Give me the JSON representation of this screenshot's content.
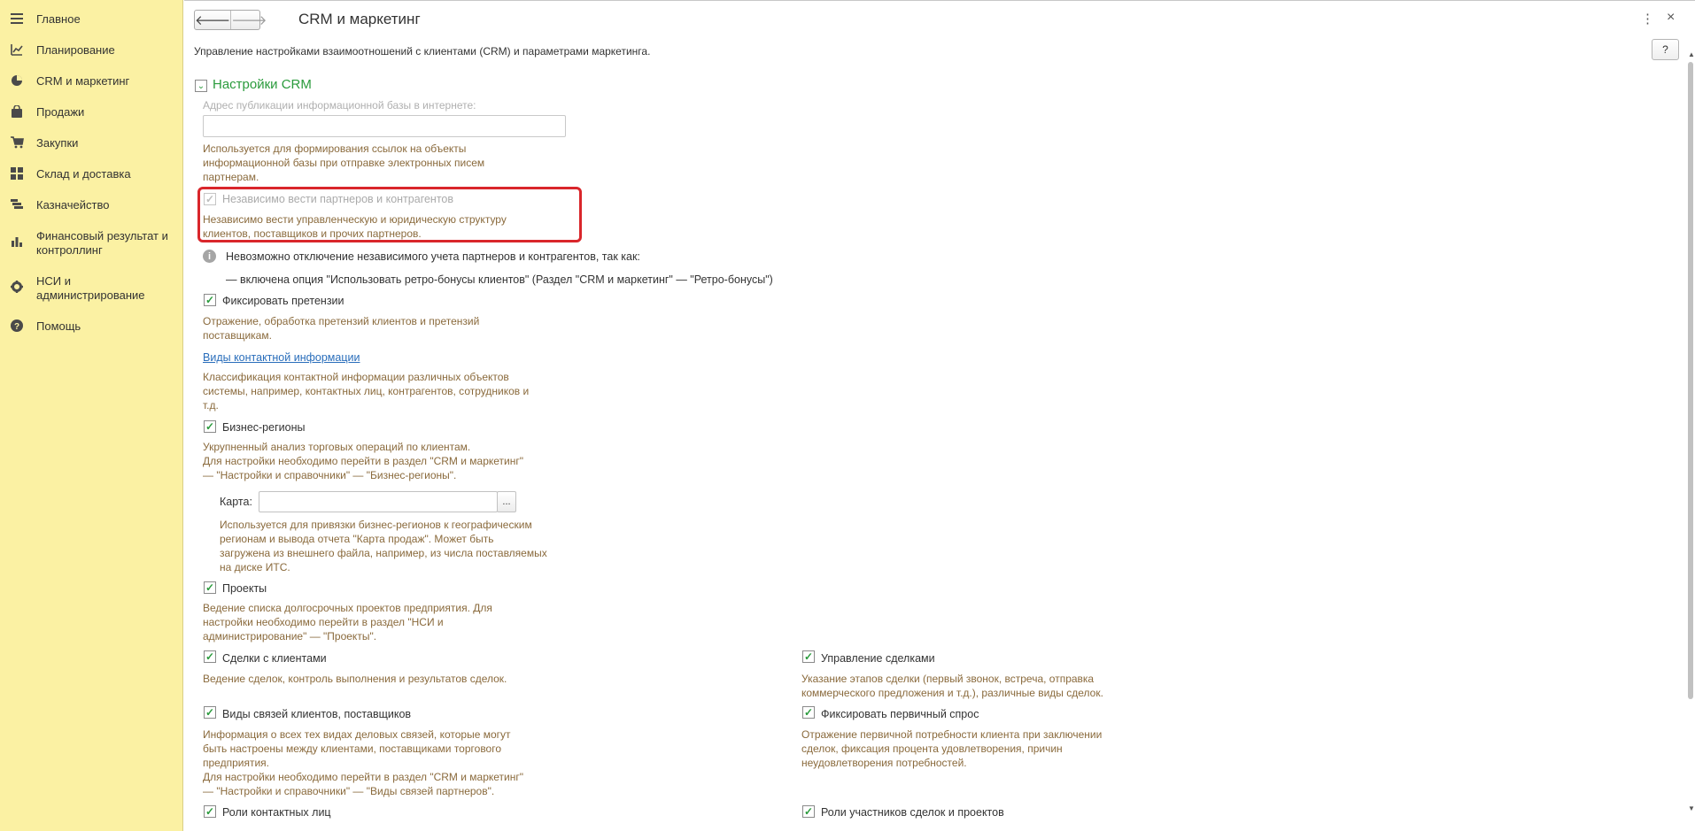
{
  "sidebar": {
    "items": [
      {
        "icon": "hamburger-icon",
        "label": "Главное"
      },
      {
        "icon": "planning-icon",
        "label": "Планирование"
      },
      {
        "icon": "pie-chart-icon",
        "label": "CRM и маркетинг"
      },
      {
        "icon": "bag-icon",
        "label": "Продажи"
      },
      {
        "icon": "cart-icon",
        "label": "Закупки"
      },
      {
        "icon": "warehouse-icon",
        "label": "Склад и доставка"
      },
      {
        "icon": "treasury-icon",
        "label": "Казначейство"
      },
      {
        "icon": "bar-chart-icon",
        "label": "Финансовый результат и контроллинг"
      },
      {
        "icon": "gear-icon",
        "label": "НСИ и администрирование"
      },
      {
        "icon": "help-icon",
        "label": "Помощь"
      }
    ]
  },
  "header": {
    "back_label": "🡐",
    "forward_label": "🡒",
    "title": "CRM и маркетинг",
    "menu_label": "⋮",
    "close_label": "×",
    "subtitle": "Управление настройками взаимоотношений с клиентами (CRM) и параметрами маркетинга.",
    "help_label": "?"
  },
  "section": {
    "toggle_glyph": "⌄",
    "title": "Настройки CRM",
    "publication_address": {
      "label": "Адрес публикации информационной базы в интернете:",
      "value": "",
      "description": [
        "Используется для формирования ссылок на объекты",
        "информационной базы при отправке электронных писем",
        "партнерам."
      ]
    },
    "independent_partners": {
      "checked": true,
      "disabled": true,
      "label": "Независимо вести партнеров и контрагентов",
      "description": [
        "Независимо вести управленческую и юридическую структуру",
        "клиентов, поставщиков и прочих партнеров."
      ]
    },
    "info": {
      "icon": "info-icon",
      "text": "Невозможно отключение независимого учета партнеров и контрагентов, так как:",
      "reason": "— включена опция \"Использовать ретро-бонусы клиентов\" (Раздел \"CRM и маркетинг\" — \"Ретро-бонусы\")"
    },
    "claims": {
      "checked": true,
      "label": "Фиксировать претензии",
      "description": [
        "Отражение, обработка претензий клиентов и претензий",
        "поставщикам."
      ]
    },
    "contact_info_link": {
      "label": "Виды контактной информации",
      "description": [
        "Классификация контактной информации различных объектов",
        "системы, например, контактных лиц, контрагентов, сотрудников и",
        "т.д."
      ]
    },
    "business_regions": {
      "checked": true,
      "label": "Бизнес-регионы",
      "description": [
        "Укрупненный анализ торговых операций по клиентам.",
        "Для настройки необходимо перейти в раздел \"CRM и маркетинг\"",
        "— \"Настройки и справочники\" — \"Бизнес-регионы\"."
      ],
      "map_label": "Карта:",
      "map_value": "",
      "map_button": "...",
      "map_description": [
        "Используется для привязки бизнес-регионов к географическим",
        "регионам и вывода отчета \"Карта продаж\". Может быть",
        "загружена из внешнего файла, например, из числа поставляемых",
        "на диске ИТС."
      ]
    },
    "projects": {
      "checked": true,
      "label": "Проекты",
      "description": [
        "Ведение списка долгосрочных проектов предприятия. Для",
        "настройки необходимо перейти в раздел \"НСИ и",
        "администрирование\" — \"Проекты\"."
      ]
    },
    "deals": {
      "checked": true,
      "label": "Сделки с клиентами",
      "description": [
        "Ведение сделок, контроль выполнения и результатов сделок."
      ]
    },
    "deal_management": {
      "checked": true,
      "label": "Управление сделками",
      "description": [
        "Указание этапов сделки (первый звонок, встреча, отправка",
        "коммерческого предложения и т.д.), различные виды сделок."
      ]
    },
    "relations": {
      "checked": true,
      "label": "Виды связей клиентов, поставщиков",
      "description": [
        "Информация о всех тех видах деловых связей, которые могут",
        "быть настроены между клиентами, поставщиками торгового",
        "предприятия.",
        "Для настройки необходимо перейти в раздел \"CRM и маркетинг\"",
        "— \"Настройки и справочники\" — \"Виды связей партнеров\"."
      ]
    },
    "primary_demand": {
      "checked": true,
      "label": "Фиксировать первичный спрос",
      "description": [
        "Отражение первичной потребности клиента при заключении",
        "сделок, фиксация процента удовлетворения, причин",
        "неудовлетворения потребностей."
      ]
    },
    "contact_roles": {
      "checked": true,
      "label": "Роли контактных лиц"
    },
    "participant_roles": {
      "checked": true,
      "label": "Роли участников сделок и проектов"
    }
  }
}
